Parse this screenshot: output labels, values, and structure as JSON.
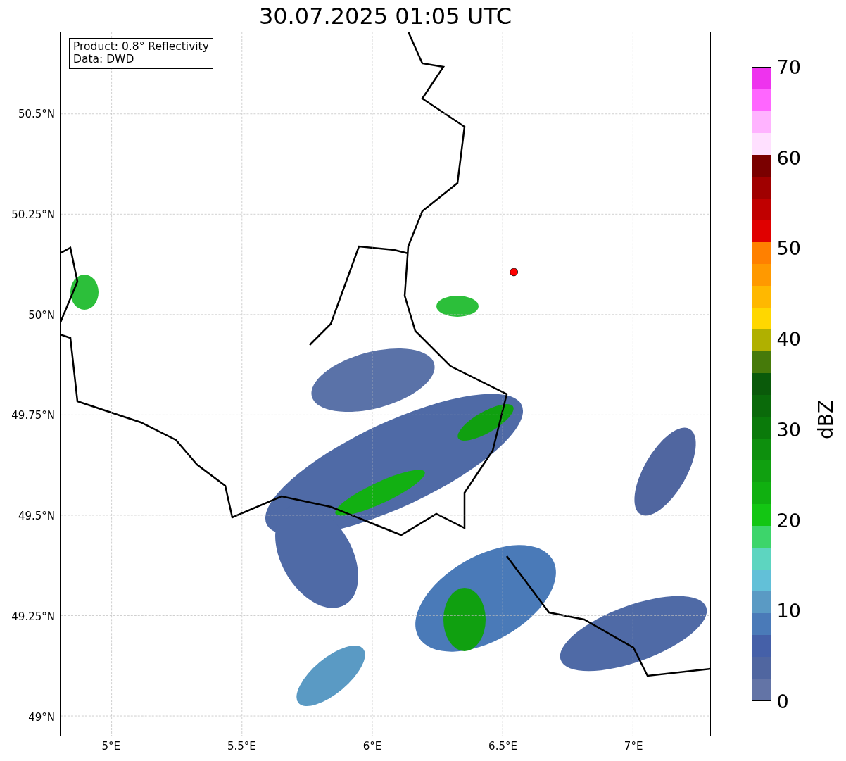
{
  "title": "30.07.2025 01:05 UTC",
  "legend": [
    "Product: 0.8° Reflectivity",
    "Data: DWD"
  ],
  "map": {
    "chart_data": {
      "type": "scatter",
      "xlim": [
        4.804,
        7.296
      ],
      "ylim": [
        48.951,
        50.703
      ],
      "xticks": [
        {
          "value": 5,
          "label": "5°E"
        },
        {
          "value": 5.5,
          "label": "5.5°E"
        },
        {
          "value": 6,
          "label": "6°E"
        },
        {
          "value": 6.5,
          "label": "6.5°E"
        },
        {
          "value": 7,
          "label": "7°E"
        }
      ],
      "yticks": [
        {
          "value": 49,
          "label": "49°N"
        },
        {
          "value": 49.25,
          "label": "49.25°N"
        },
        {
          "value": 49.5,
          "label": "49.5°N"
        },
        {
          "value": 49.75,
          "label": "49.75°N"
        },
        {
          "value": 50,
          "label": "50°N"
        },
        {
          "value": 50.25,
          "label": "50.25°N"
        },
        {
          "value": 50.5,
          "label": "50.5°N"
        }
      ],
      "grid": true,
      "x": [
        6.543
      ],
      "series": [
        {
          "color": "#ff0000",
          "values": [
            50.106
          ]
        }
      ]
    }
  },
  "colorbar": {
    "label": "dBZ",
    "ticks": [
      "70",
      "60",
      "50",
      "40",
      "30",
      "20",
      "10",
      "0"
    ],
    "bins": [
      {
        "color": "#ee33ee"
      },
      {
        "color": "#ff66ff"
      },
      {
        "color": "#ffb3ff"
      },
      {
        "color": "#ffe0ff"
      },
      {
        "color": "#7a0000"
      },
      {
        "color": "#a00000"
      },
      {
        "color": "#c00000"
      },
      {
        "color": "#e00000"
      },
      {
        "color": "#ff8000"
      },
      {
        "color": "#ff9900"
      },
      {
        "color": "#ffb800"
      },
      {
        "color": "#ffd700"
      },
      {
        "color": "#b0b000"
      },
      {
        "color": "#467a0a"
      },
      {
        "color": "#0a5a0a"
      },
      {
        "color": "#0a6a0a"
      },
      {
        "color": "#0a7a0a"
      },
      {
        "color": "#0d8f0d"
      },
      {
        "color": "#10a010"
      },
      {
        "color": "#10b010"
      },
      {
        "color": "#13c613"
      },
      {
        "color": "#3dd56b"
      },
      {
        "color": "#5dd5c0"
      },
      {
        "color": "#62c0d8"
      },
      {
        "color": "#5a9ac4"
      },
      {
        "color": "#4a7ab8"
      },
      {
        "color": "#4560a8"
      },
      {
        "color": "#5066a0"
      },
      {
        "color": "#6374a6"
      }
    ]
  }
}
